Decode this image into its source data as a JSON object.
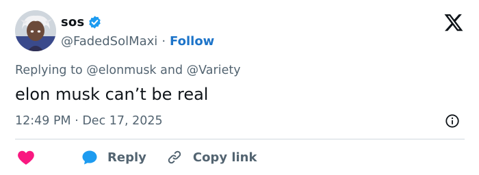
{
  "author": {
    "display_name": "sos",
    "handle": "@FadedSolMaxi",
    "separator": "·",
    "follow_label": "Follow",
    "verified_icon": "verified-badge-icon",
    "verified_color": "#1d9bf0"
  },
  "platform_icon": "x-logo-icon",
  "reply_context": {
    "prefix": "Replying to",
    "mention_1": "@elonmusk",
    "joiner": "and",
    "mention_2": "@Variety"
  },
  "tweet": {
    "text": "elon musk can’t be real",
    "timestamp": "12:49 PM · Dec 17, 2025"
  },
  "actions": {
    "like_icon": "heart-icon",
    "like_color": "#f91880",
    "reply_label": "Reply",
    "reply_icon_color": "#1d9bf0",
    "copy_link_label": "Copy link"
  },
  "colors": {
    "link": "#1d74c9",
    "secondary_text": "#536471",
    "primary_text": "#0f1419"
  }
}
